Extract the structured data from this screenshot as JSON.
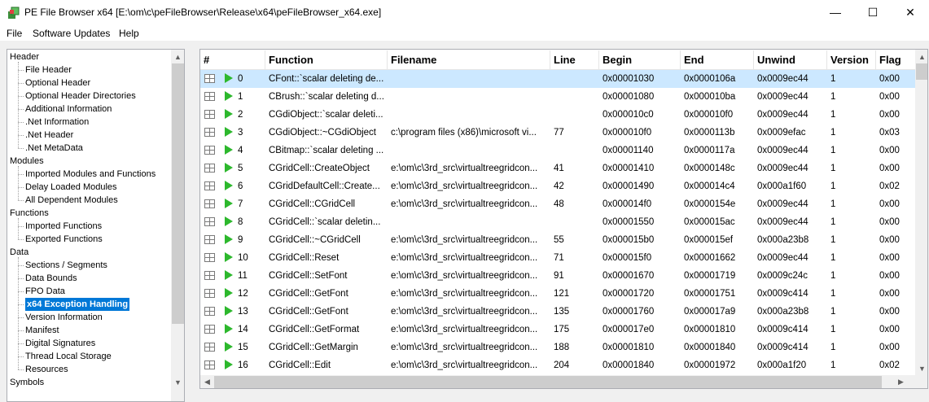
{
  "window": {
    "title": "PE File Browser x64 [E:\\om\\c\\peFileBrowser\\Release\\x64\\peFileBrowser_x64.exe]",
    "minimize": "—",
    "maximize": "☐",
    "close": "✕"
  },
  "menu": [
    "File",
    "Software Updates",
    "Help"
  ],
  "tree": [
    {
      "label": "Header",
      "level": 0
    },
    {
      "label": "File Header",
      "level": 1
    },
    {
      "label": "Optional Header",
      "level": 1
    },
    {
      "label": "Optional Header Directories",
      "level": 1
    },
    {
      "label": "Additional Information",
      "level": 1
    },
    {
      "label": ".Net Information",
      "level": 1
    },
    {
      "label": ".Net Header",
      "level": 1
    },
    {
      "label": ".Net MetaData",
      "level": 1
    },
    {
      "label": "Modules",
      "level": 0
    },
    {
      "label": "Imported Modules and Functions",
      "level": 1
    },
    {
      "label": "Delay Loaded Modules",
      "level": 1
    },
    {
      "label": "All Dependent Modules",
      "level": 1
    },
    {
      "label": "Functions",
      "level": 0
    },
    {
      "label": "Imported Functions",
      "level": 1
    },
    {
      "label": "Exported Functions",
      "level": 1
    },
    {
      "label": "Data",
      "level": 0
    },
    {
      "label": "Sections / Segments",
      "level": 1
    },
    {
      "label": "Data Bounds",
      "level": 1
    },
    {
      "label": "FPO Data",
      "level": 1
    },
    {
      "label": "x64 Exception Handling",
      "level": 1,
      "selected": true
    },
    {
      "label": "Version Information",
      "level": 1
    },
    {
      "label": "Manifest",
      "level": 1
    },
    {
      "label": "Digital Signatures",
      "level": 1
    },
    {
      "label": "Thread Local Storage",
      "level": 1
    },
    {
      "label": "Resources",
      "level": 1
    },
    {
      "label": "Symbols",
      "level": 0
    }
  ],
  "grid": {
    "columns": [
      "#",
      "Function",
      "Filename",
      "Line",
      "Begin",
      "End",
      "Unwind",
      "Version",
      "Flag"
    ],
    "rows": [
      [
        "0",
        "CFont::`scalar deleting de...",
        "",
        "",
        "0x00001030",
        "0x0000106a",
        "0x0009ec44",
        "1",
        "0x00"
      ],
      [
        "1",
        "CBrush::`scalar deleting d...",
        "",
        "",
        "0x00001080",
        "0x000010ba",
        "0x0009ec44",
        "1",
        "0x00"
      ],
      [
        "2",
        "CGdiObject::`scalar deleti...",
        "",
        "",
        "0x000010c0",
        "0x000010f0",
        "0x0009ec44",
        "1",
        "0x00"
      ],
      [
        "3",
        "CGdiObject::~CGdiObject",
        "c:\\program files (x86)\\microsoft vi...",
        "77",
        "0x000010f0",
        "0x0000113b",
        "0x0009efac",
        "1",
        "0x03"
      ],
      [
        "4",
        "CBitmap::`scalar deleting ...",
        "",
        "",
        "0x00001140",
        "0x0000117a",
        "0x0009ec44",
        "1",
        "0x00"
      ],
      [
        "5",
        "CGridCell::CreateObject",
        "e:\\om\\c\\3rd_src\\virtualtreegridcon...",
        "41",
        "0x00001410",
        "0x0000148c",
        "0x0009ec44",
        "1",
        "0x00"
      ],
      [
        "6",
        "CGridDefaultCell::Create...",
        "e:\\om\\c\\3rd_src\\virtualtreegridcon...",
        "42",
        "0x00001490",
        "0x000014c4",
        "0x000a1f60",
        "1",
        "0x02"
      ],
      [
        "7",
        "CGridCell::CGridCell",
        "e:\\om\\c\\3rd_src\\virtualtreegridcon...",
        "48",
        "0x000014f0",
        "0x0000154e",
        "0x0009ec44",
        "1",
        "0x00"
      ],
      [
        "8",
        "CGridCell::`scalar deletin...",
        "",
        "",
        "0x00001550",
        "0x000015ac",
        "0x0009ec44",
        "1",
        "0x00"
      ],
      [
        "9",
        "CGridCell::~CGridCell",
        "e:\\om\\c\\3rd_src\\virtualtreegridcon...",
        "55",
        "0x000015b0",
        "0x000015ef",
        "0x000a23b8",
        "1",
        "0x00"
      ],
      [
        "10",
        "CGridCell::Reset",
        "e:\\om\\c\\3rd_src\\virtualtreegridcon...",
        "71",
        "0x000015f0",
        "0x00001662",
        "0x0009ec44",
        "1",
        "0x00"
      ],
      [
        "11",
        "CGridCell::SetFont",
        "e:\\om\\c\\3rd_src\\virtualtreegridcon...",
        "91",
        "0x00001670",
        "0x00001719",
        "0x0009c24c",
        "1",
        "0x00"
      ],
      [
        "12",
        "CGridCell::GetFont",
        "e:\\om\\c\\3rd_src\\virtualtreegridcon...",
        "121",
        "0x00001720",
        "0x00001751",
        "0x0009c414",
        "1",
        "0x00"
      ],
      [
        "13",
        "CGridCell::GetFont",
        "e:\\om\\c\\3rd_src\\virtualtreegridcon...",
        "135",
        "0x00001760",
        "0x000017a9",
        "0x000a23b8",
        "1",
        "0x00"
      ],
      [
        "14",
        "CGridCell::GetFormat",
        "e:\\om\\c\\3rd_src\\virtualtreegridcon...",
        "175",
        "0x000017e0",
        "0x00001810",
        "0x0009c414",
        "1",
        "0x00"
      ],
      [
        "15",
        "CGridCell::GetMargin",
        "e:\\om\\c\\3rd_src\\virtualtreegridcon...",
        "188",
        "0x00001810",
        "0x00001840",
        "0x0009c414",
        "1",
        "0x00"
      ],
      [
        "16",
        "CGridCell::Edit",
        "e:\\om\\c\\3rd_src\\virtualtreegridcon...",
        "204",
        "0x00001840",
        "0x00001972",
        "0x000a1f20",
        "1",
        "0x02"
      ]
    ],
    "selected_row": 0
  }
}
